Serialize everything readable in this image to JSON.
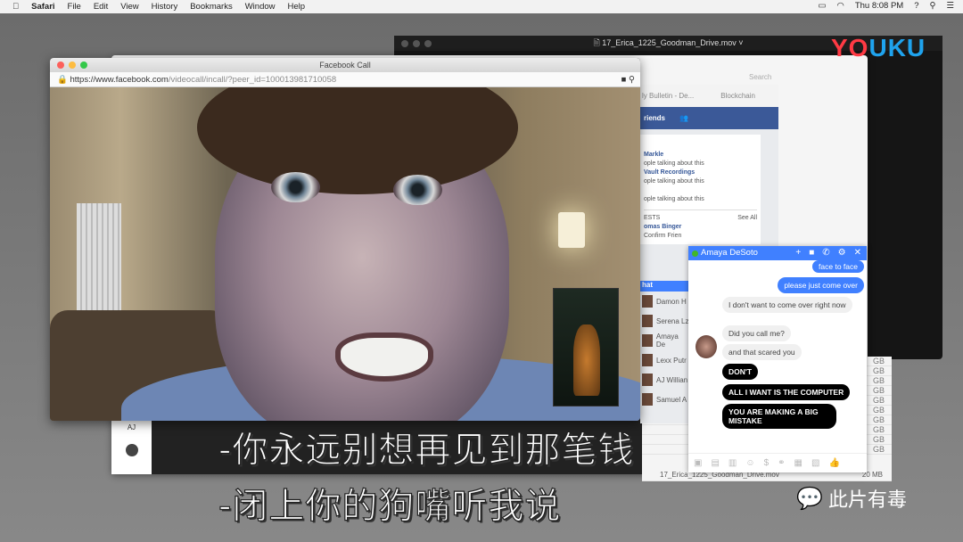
{
  "menubar": {
    "apple": "",
    "app": "Safari",
    "items": [
      "File",
      "Edit",
      "View",
      "History",
      "Bookmarks",
      "Window",
      "Help"
    ],
    "clock": "Thu 8:08 PM",
    "right_icons": [
      "airplay-icon",
      "wifi-icon",
      "help-icon",
      "search-icon",
      "list-icon"
    ]
  },
  "quicktime": {
    "title": "17_Erica_1225_Goodman_Drive.mov"
  },
  "call_window": {
    "title": "Facebook Call",
    "url_host": "https://www.facebook.com",
    "url_path": "/videocall/incall/?peer_id=100013981710058"
  },
  "back_window": {
    "search_placeholder": "Search",
    "sidebar_initials": "AJ"
  },
  "fb_page": {
    "tabs": [
      "ly Bulletin - De...",
      "Blockchain"
    ],
    "nav_label": "riends",
    "trending": [
      {
        "title": "Markle",
        "sub": "ople talking about this"
      },
      {
        "title": "Vault Recordings",
        "sub": "ople talking about this"
      },
      {
        "title": "",
        "sub": "ople talking about this"
      }
    ],
    "requests_label": "ESTS",
    "see_all": "See All",
    "request_name": "omas Binger",
    "confirm": "Confirm Frien",
    "chat_header": "hat",
    "chat_contacts": [
      "Damon H",
      "Serena Lz",
      "Amaya De",
      "Lexx Putr",
      "AJ Willian",
      "Samuel A"
    ]
  },
  "file_list": {
    "sizes": [
      "GB",
      "GB",
      "GB",
      "GB",
      "GB",
      "GB",
      "GB",
      "GB",
      "GB",
      "GB"
    ],
    "last_name": "17_Erica_1225_Goodman_Drive.mov",
    "last_size": "20 MB"
  },
  "messenger": {
    "contact": "Amaya DeSoto",
    "status_color": "#42b72a",
    "accent": "#4080ff",
    "messages": [
      {
        "from": "me",
        "text": "face to face"
      },
      {
        "from": "me",
        "text": "please just come over"
      },
      {
        "from": "them",
        "text": "I don't want to come over right now"
      },
      {
        "from": "them",
        "text": "Did you call me?"
      },
      {
        "from": "them",
        "text": "and that scared you"
      },
      {
        "from": "them_black",
        "text": "DON'T"
      },
      {
        "from": "them_black",
        "text": "ALL I WANT IS THE COMPUTER"
      },
      {
        "from": "them_black",
        "text": "YOU ARE MAKING A BIG MISTAKE"
      }
    ]
  },
  "subtitles": [
    "-你永远别想再见到那笔钱",
    "-闭上你的狗嘴听我说"
  ],
  "watermarks": {
    "youku": "YOUKU",
    "wechat": "此片有毒"
  }
}
